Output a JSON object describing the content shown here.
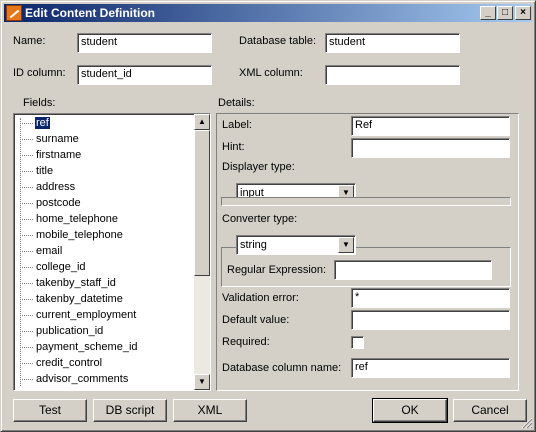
{
  "window": {
    "title": "Edit Content Definition"
  },
  "titlebar": {
    "minimize": "_",
    "maximize": "□",
    "close": "×"
  },
  "form": {
    "name_label": "Name:",
    "name_value": "student",
    "table_label": "Database table:",
    "table_value": "student",
    "id_label": "ID column:",
    "id_value": "student_id",
    "xml_label": "XML column:",
    "xml_value": ""
  },
  "fields": {
    "label": "Fields:",
    "items": [
      "ref",
      "surname",
      "firstname",
      "title",
      "address",
      "postcode",
      "home_telephone",
      "mobile_telephone",
      "email",
      "college_id",
      "takenby_staff_id",
      "takenby_datetime",
      "current_employment",
      "publication_id",
      "payment_scheme_id",
      "credit_control",
      "advisor_comments"
    ],
    "selected_index": 0
  },
  "details": {
    "label": "Details:",
    "label_label": "Label:",
    "label_value": "Ref",
    "hint_label": "Hint:",
    "hint_value": "",
    "displayer_label": "Displayer type:",
    "displayer_value": "input",
    "converter_label": "Converter type:",
    "converter_value": "string",
    "regex_label": "Regular Expression:",
    "regex_value": "",
    "validation_label": "Validation error:",
    "validation_value": "*",
    "default_label": "Default value:",
    "default_value": "",
    "required_label": "Required:",
    "required_checked": false,
    "dbcolumn_label": "Database column name:",
    "dbcolumn_value": "ref"
  },
  "buttons": {
    "test": "Test",
    "dbscript": "DB script",
    "xml": "XML",
    "ok": "OK",
    "cancel": "Cancel"
  }
}
